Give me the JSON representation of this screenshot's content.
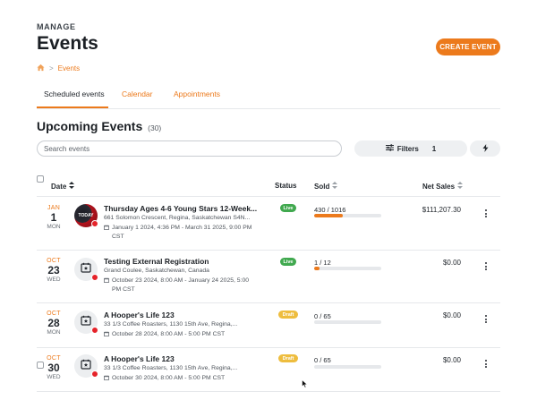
{
  "header": {
    "eyebrow": "MANAGE",
    "title": "Events",
    "create_label": "CREATE EVENT"
  },
  "breadcrumb": {
    "separator": ">",
    "current": "Events",
    "home_icon": "home-icon"
  },
  "tabs": [
    {
      "label": "Scheduled events",
      "active": true
    },
    {
      "label": "Calendar",
      "active": false
    },
    {
      "label": "Appointments",
      "active": false
    }
  ],
  "section": {
    "title": "Upcoming Events",
    "count": "(30)"
  },
  "search": {
    "placeholder": "Search events"
  },
  "filters": {
    "label": "Filters",
    "count": "1"
  },
  "table": {
    "headers": {
      "date": "Date",
      "status": "Status",
      "sold": "Sold",
      "net_sales": "Net Sales"
    },
    "rows": [
      {
        "month": "JAN",
        "day": "1",
        "dow": "MON",
        "title": "Thursday Ages 4-6 Young Stars 12-Week...",
        "address": "661 Solomon Crescent, Regina, Saskatchewan S4N...",
        "time_line1": "January 1 2024, 4:36 PM - March 31 2025, 9:00 PM",
        "time_line2": "CST",
        "status": "Live",
        "sold": "430 / 1016",
        "sold_fraction": 0.423,
        "net": "$111,207.30",
        "thumb_text": "TODAY"
      },
      {
        "month": "OCT",
        "day": "23",
        "dow": "WED",
        "title": "Testing External Registration",
        "address": "Grand Coulee, Saskatchewan, Canada",
        "time_line1": "October 23 2024, 8:00 AM - January 24 2025, 5:00",
        "time_line2": "PM CST",
        "status": "Live",
        "sold": "1 / 12",
        "sold_fraction": 0.083,
        "net": "$0.00"
      },
      {
        "month": "OCT",
        "day": "28",
        "dow": "MON",
        "title": "A Hooper's Life 123",
        "address": "33 1/3 Coffee Roasters, 1130 15th Ave, Regina,...",
        "time_line1": "October 28 2024, 8:00 AM - 5:00 PM CST",
        "time_line2": "",
        "status": "Draft",
        "sold": "0 / 65",
        "sold_fraction": 0,
        "net": "$0.00"
      },
      {
        "month": "OCT",
        "day": "30",
        "dow": "WED",
        "title": "A Hooper's Life 123",
        "address": "33 1/3 Coffee Roasters, 1130 15th Ave, Regina,...",
        "time_line1": "October 30 2024, 8:00 AM - 5:00 PM CST",
        "time_line2": "",
        "status": "Draft",
        "sold": "0 / 65",
        "sold_fraction": 0,
        "net": "$0.00"
      }
    ]
  },
  "colors": {
    "accent": "#ec7a1c",
    "live": "#41a94f",
    "draft": "#eebd3e",
    "badge": "#e5232a"
  }
}
